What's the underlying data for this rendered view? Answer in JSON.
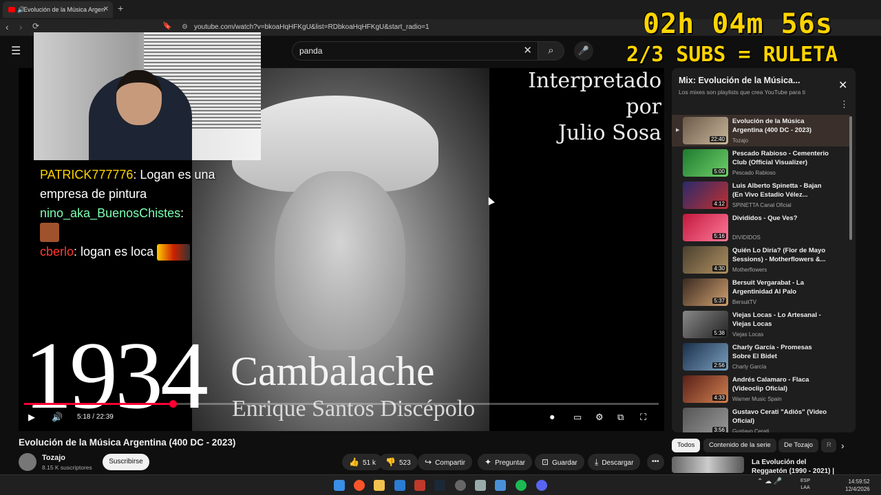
{
  "browser": {
    "tab_title": "Evolución de la Música Argen",
    "url": "youtube.com/watch?v=bkoaHqHFKgU&list=RDbkoaHqHFKgU&start_radio=1"
  },
  "stream_overlay": {
    "timer": "02h 04m 56s",
    "subs_goal": "2/3 SUBS = RULETA",
    "chat": [
      {
        "user": "PATRICK777776",
        "text": ": Logan es una empresa de pintura"
      },
      {
        "user": "nino_aka_BuenosChistes",
        "text": ":"
      },
      {
        "user": "cberlo",
        "text": ": logan es loca"
      }
    ]
  },
  "search": {
    "query": "panda"
  },
  "video": {
    "overlay_interp": "Interpretado por",
    "overlay_artist": "Julio Sosa",
    "year": "1934",
    "song": "Cambalache",
    "author": "Enrique Santos Discépolo",
    "time_current": "5:18",
    "time_total": "22:39",
    "progress": 0.234,
    "title": "Evolución de la Música Argentina (400 DC - 2023)",
    "channel": "Tozajo",
    "channel_subs": "8.15 K suscriptores",
    "subscribe_label": "Suscribirse",
    "likes": "51 k",
    "dislikes": "523",
    "share_label": "Compartir",
    "ask_label": "Preguntar",
    "save_label": "Guardar",
    "download_label": "Descargar"
  },
  "playlist": {
    "title": "Mix: Evolución de la Música...",
    "subtitle": "Los mixes son playlists que crea YouTube para ti",
    "items": [
      {
        "title": "Evolución de la Música Argentina (400 DC - 2023)",
        "channel": "Tozajo",
        "duration": "22:40"
      },
      {
        "title": "Pescado Rabioso - Cementerio Club (Official Visualizer)",
        "channel": "Pescado Rabioso",
        "duration": "5:00"
      },
      {
        "title": "Luis Alberto Spinetta - Bajan (En Vivo Estadio Vélez...",
        "channel": "SPINETTA Canal Oficial",
        "duration": "4:12"
      },
      {
        "title": "Divididos - Que Ves?",
        "channel": "DIVIDIDOS",
        "duration": "5:16"
      },
      {
        "title": "Quién Lo Diría? (Flor de Mayo Sessions) - Motherflowers &...",
        "channel": "Motherflowers",
        "duration": "4:30"
      },
      {
        "title": "Bersuit Vergarabat - La Argentinidad Al Palo",
        "channel": "BersuitTV",
        "duration": "5:37"
      },
      {
        "title": "Viejas Locas - Lo Artesanal - Viejas Locas",
        "channel": "Viejas Locas",
        "duration": "5:38"
      },
      {
        "title": "Charly García - Promesas Sobre El Bidet",
        "channel": "Charly García",
        "duration": "2:56"
      },
      {
        "title": "Andrés Calamaro - Flaca (Videoclip Oficial)",
        "channel": "Warner Music Spain",
        "duration": "4:33"
      },
      {
        "title": "Gustavo Cerati \"Adiós\" (Video Oficial)",
        "channel": "Gustavo Cerati",
        "duration": "3:56"
      }
    ]
  },
  "chips": [
    "Todos",
    "Contenido de la serie",
    "De Tozajo",
    "R"
  ],
  "recommended": {
    "title": "La Evolución del Reggaetón (1990 - 2021) | Historia del ..."
  },
  "taskbar": {
    "lang1": "ESP",
    "lang2": "LAA",
    "time": "14:59:52",
    "date": "12/4/2026"
  }
}
